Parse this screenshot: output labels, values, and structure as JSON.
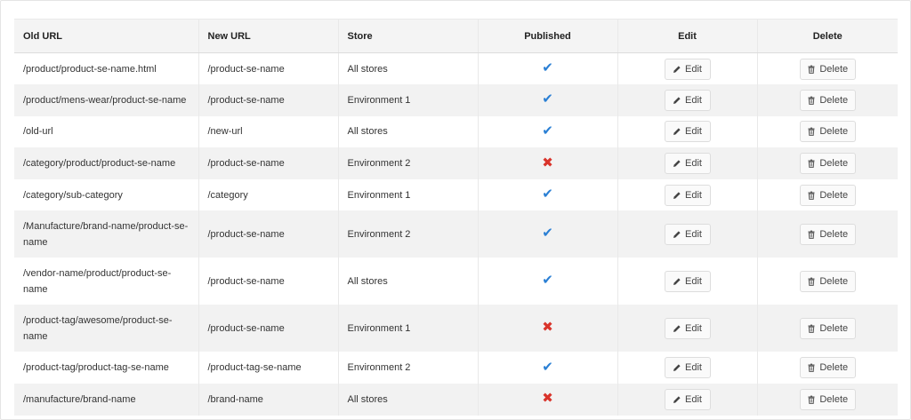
{
  "table": {
    "headers": {
      "old_url": "Old URL",
      "new_url": "New URL",
      "store": "Store",
      "published": "Published",
      "edit": "Edit",
      "delete": "Delete"
    },
    "edit_label": "Edit",
    "delete_label": "Delete",
    "rows": [
      {
        "old_url": "/product/product-se-name.html",
        "new_url": "/product-se-name",
        "store": "All stores",
        "published": true
      },
      {
        "old_url": "/product/mens-wear/product-se-name",
        "new_url": "/product-se-name",
        "store": "Environment 1",
        "published": true
      },
      {
        "old_url": "/old-url",
        "new_url": "/new-url",
        "store": "All stores",
        "published": true
      },
      {
        "old_url": "/category/product/product-se-name",
        "new_url": "/product-se-name",
        "store": "Environment 2",
        "published": false
      },
      {
        "old_url": "/category/sub-category",
        "new_url": "/category",
        "store": "Environment 1",
        "published": true
      },
      {
        "old_url": "/Manufacture/brand-name/product-se-name",
        "new_url": "/product-se-name",
        "store": "Environment 2",
        "published": true
      },
      {
        "old_url": "/vendor-name/product/product-se-name",
        "new_url": "/product-se-name",
        "store": "All stores",
        "published": true
      },
      {
        "old_url": "/product-tag/awesome/product-se-name",
        "new_url": "/product-se-name",
        "store": "Environment 1",
        "published": false
      },
      {
        "old_url": "/product-tag/product-tag-se-name",
        "new_url": "/product-tag-se-name",
        "store": "Environment 2",
        "published": true
      },
      {
        "old_url": "/manufacture/brand-name",
        "new_url": "/brand-name",
        "store": "All stores",
        "published": false
      }
    ]
  },
  "icons": {
    "published_true": "check-icon",
    "published_false": "cross-icon",
    "edit": "pencil-icon",
    "delete": "trash-icon"
  },
  "colors": {
    "check": "#2a7fd4",
    "cross": "#d9342b",
    "header_bg": "#f4f4f4",
    "stripe_bg": "#f2f2f2"
  }
}
